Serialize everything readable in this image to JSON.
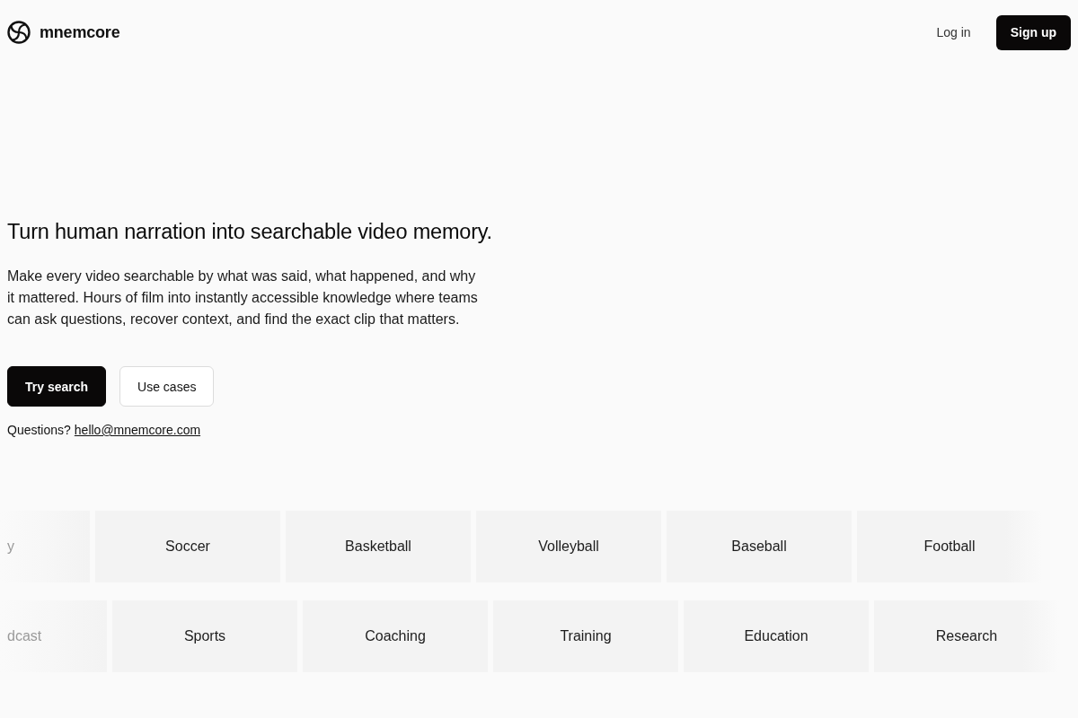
{
  "header": {
    "brand": "mnemcore",
    "login": "Log in",
    "signup": "Sign up"
  },
  "hero": {
    "headline": "Turn human narration into searchable video memory.",
    "body": "Make every video searchable by what was said, what happened, and why it mattered. Hours of film into instantly accessible knowledge where teams can ask questions, recover context, and find the exact clip that matters.",
    "buttons": [
      {
        "label": "Try search",
        "kind": "primary"
      },
      {
        "label": "Use cases",
        "kind": "secondary"
      }
    ],
    "contact": {
      "label": "Questions?",
      "email": "hello@mnemcore.com"
    }
  },
  "marquee": {
    "rows": [
      {
        "lead": "y",
        "tiles": [
          "Soccer",
          "Basketball",
          "Volleyball",
          "Baseball",
          "Football"
        ]
      },
      {
        "lead": "dcast",
        "tiles": [
          "Sports",
          "Coaching",
          "Training",
          "Education",
          "Research"
        ]
      }
    ]
  }
}
